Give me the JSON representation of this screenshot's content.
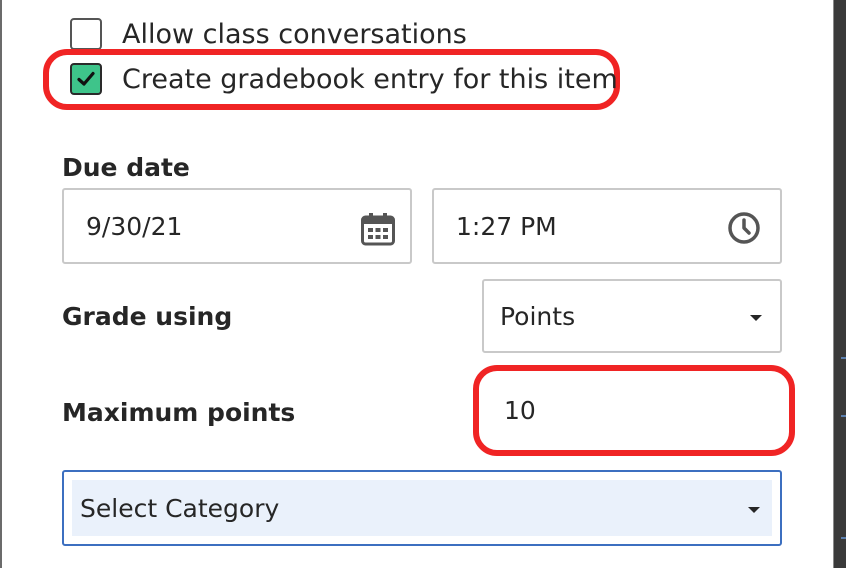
{
  "checkboxes": [
    {
      "label": "Allow class conversations",
      "checked": false,
      "icon": "checkbox-empty"
    },
    {
      "label": "Create gradebook entry for this item",
      "checked": true,
      "icon": "checkmark-icon"
    }
  ],
  "due_date": {
    "label": "Due date",
    "date_value": "9/30/21",
    "date_icon": "calendar-icon",
    "time_value": "1:27 PM",
    "time_icon": "clock-icon"
  },
  "grade_using": {
    "label": "Grade using",
    "selected": "Points"
  },
  "maximum_points": {
    "label": "Maximum points",
    "value": "10"
  },
  "category": {
    "selected": "Select Category"
  },
  "colors": {
    "checkbox_checked": "#3ec48a",
    "highlight": "#f02424",
    "focus_border": "#3c6fc0"
  }
}
